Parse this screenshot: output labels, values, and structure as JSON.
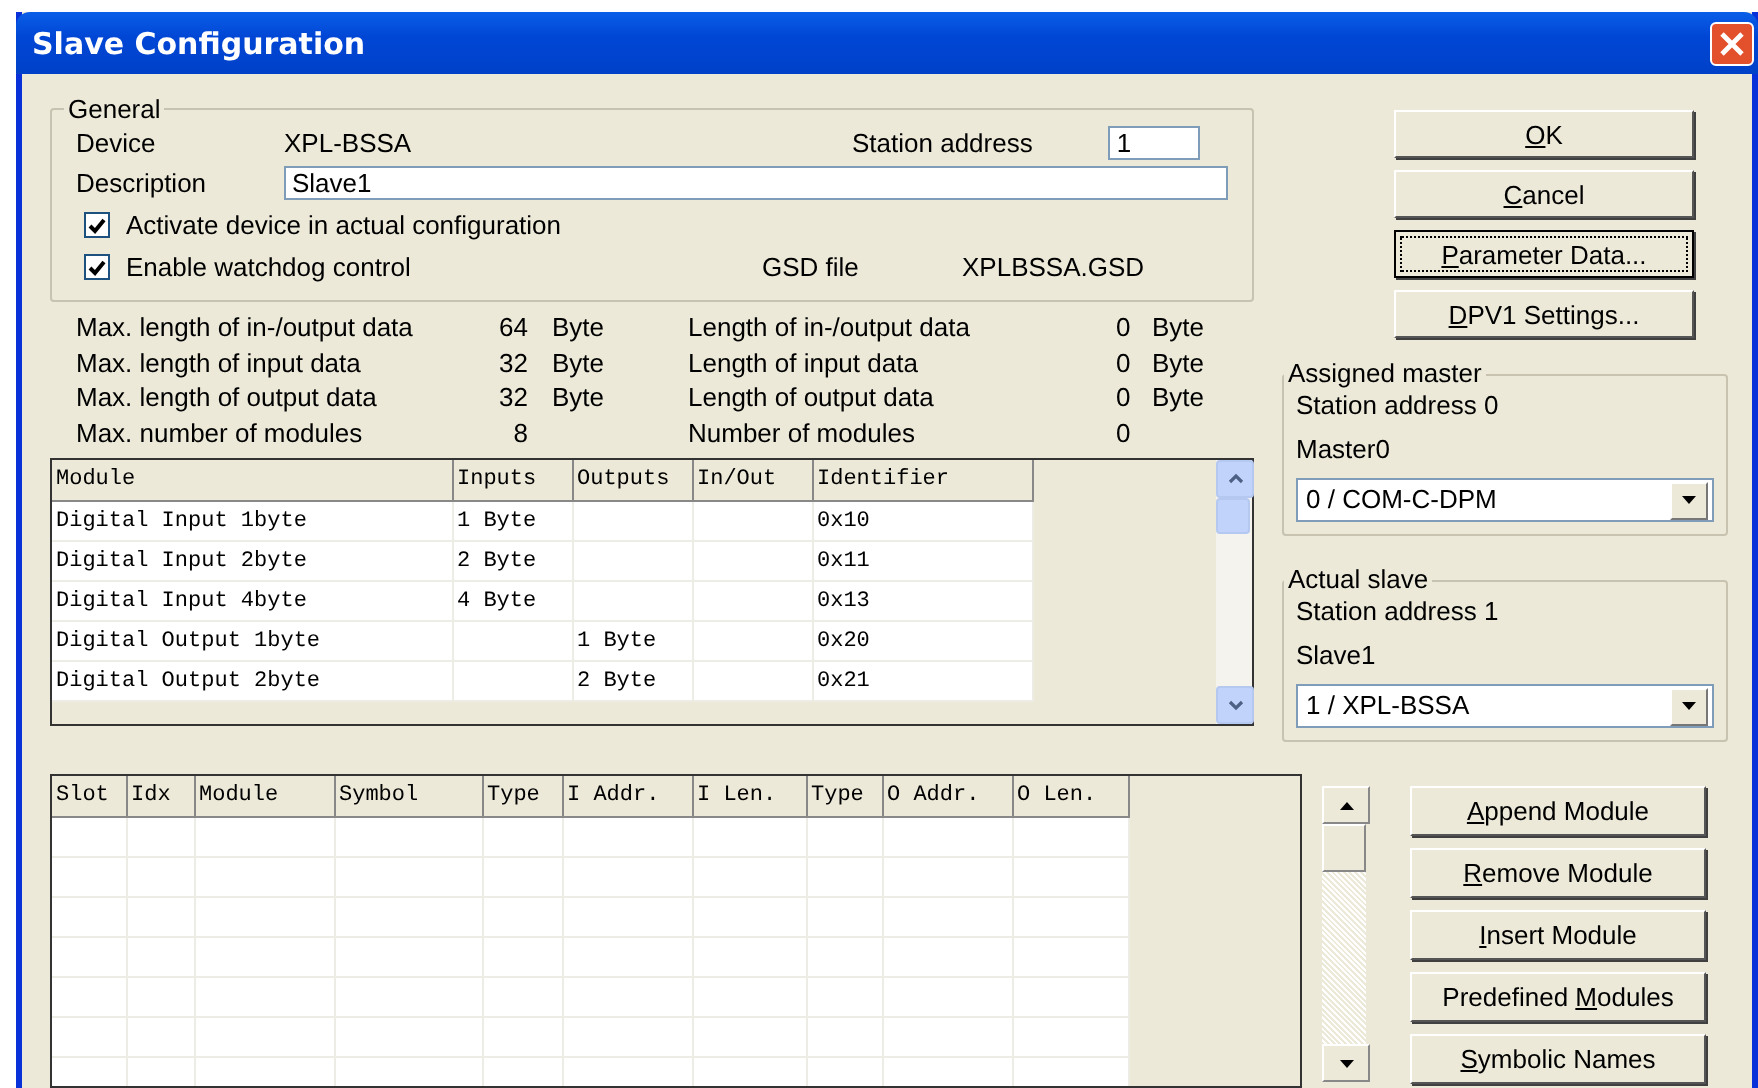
{
  "window": {
    "title": "Slave Configuration"
  },
  "general": {
    "title": "General",
    "device_label": "Device",
    "device": "XPL-BSSA",
    "station_address_label": "Station address",
    "station_address": "1",
    "description_label": "Description",
    "description": "Slave1",
    "checkboxes": [
      {
        "label": "Activate device in actual configuration",
        "checked": true
      },
      {
        "label": "Enable watchdog control",
        "checked": true
      }
    ],
    "gsd_label": "GSD file",
    "gsd_file": "XPLBSSA.GSD"
  },
  "limits": [
    {
      "label": "Max. length of in-/output data",
      "value": "64",
      "unit": "Byte",
      "current_label": "Length of in-/output data",
      "current": "0",
      "current_unit": "Byte"
    },
    {
      "label": "Max. length of input data",
      "value": "32",
      "unit": "Byte",
      "current_label": "Length of input data",
      "current": "0",
      "current_unit": "Byte"
    },
    {
      "label": "Max. length of output data",
      "value": "32",
      "unit": "Byte",
      "current_label": "Length of output data",
      "current": "0",
      "current_unit": "Byte"
    },
    {
      "label": "Max. number of modules",
      "value": "8",
      "current_label": "Number of modules",
      "current": "0"
    }
  ],
  "module_table": {
    "columns": [
      "Module",
      "Inputs",
      "Outputs",
      "In/Out",
      "Identifier"
    ],
    "rows": [
      [
        "Digital Input 1byte",
        "1 Byte",
        "",
        "",
        "0x10"
      ],
      [
        "Digital Input 2byte",
        "2 Byte",
        "",
        "",
        "0x11"
      ],
      [
        "Digital Input 4byte",
        "4 Byte",
        "",
        "",
        "0x13"
      ],
      [
        "Digital Output 1byte",
        "",
        "1 Byte",
        "",
        "0x20"
      ],
      [
        "Digital Output 2byte",
        "",
        "2 Byte",
        "",
        "0x21"
      ]
    ]
  },
  "buttons": [
    {
      "label": [
        {
          "text": "O",
          "underlined": true
        },
        {
          "text": "K",
          "underlined": false
        }
      ],
      "focused": false
    },
    {
      "label": [
        {
          "text": "C",
          "underlined": true
        },
        {
          "text": "ancel",
          "underlined": false
        }
      ],
      "focused": false
    },
    {
      "label": [
        {
          "text": "P",
          "underlined": true
        },
        {
          "text": "arameter Data...",
          "underlined": false
        }
      ],
      "focused": true
    },
    {
      "label": [
        {
          "text": "D",
          "underlined": true
        },
        {
          "text": "PV1 Settings...",
          "underlined": false
        }
      ],
      "focused": false
    }
  ],
  "assigned_master": {
    "title": "Assigned master",
    "station": "Station address 0",
    "name": "Master0",
    "selection": "0 / COM-C-DPM"
  },
  "actual_slave": {
    "title": "Actual slave",
    "station": "Station address 1",
    "name": "Slave1",
    "selection": "1 / XPL-BSSA"
  },
  "slot_table": {
    "columns": [
      "Slot",
      "Idx",
      "Module",
      "Symbol",
      "Type",
      "I Addr.",
      "I Len.",
      "Type",
      "O Addr.",
      "O Len."
    ]
  },
  "module_buttons": [
    {
      "label": [
        {
          "text": "A",
          "underlined": true
        },
        {
          "text": "ppend Module",
          "underlined": false
        }
      ]
    },
    {
      "label": [
        {
          "text": "R",
          "underlined": true
        },
        {
          "text": "emove Module",
          "underlined": false
        }
      ]
    },
    {
      "label": [
        {
          "text": "I",
          "underlined": true
        },
        {
          "text": "nsert Module",
          "underlined": false
        }
      ]
    },
    {
      "label": [
        {
          "text": "Predefined ",
          "underlined": false
        },
        {
          "text": "M",
          "underlined": true
        },
        {
          "text": "odules",
          "underlined": false
        }
      ]
    },
    {
      "label": [
        {
          "text": "S",
          "underlined": true
        },
        {
          "text": "ymbolic Names",
          "underlined": false
        }
      ]
    }
  ]
}
